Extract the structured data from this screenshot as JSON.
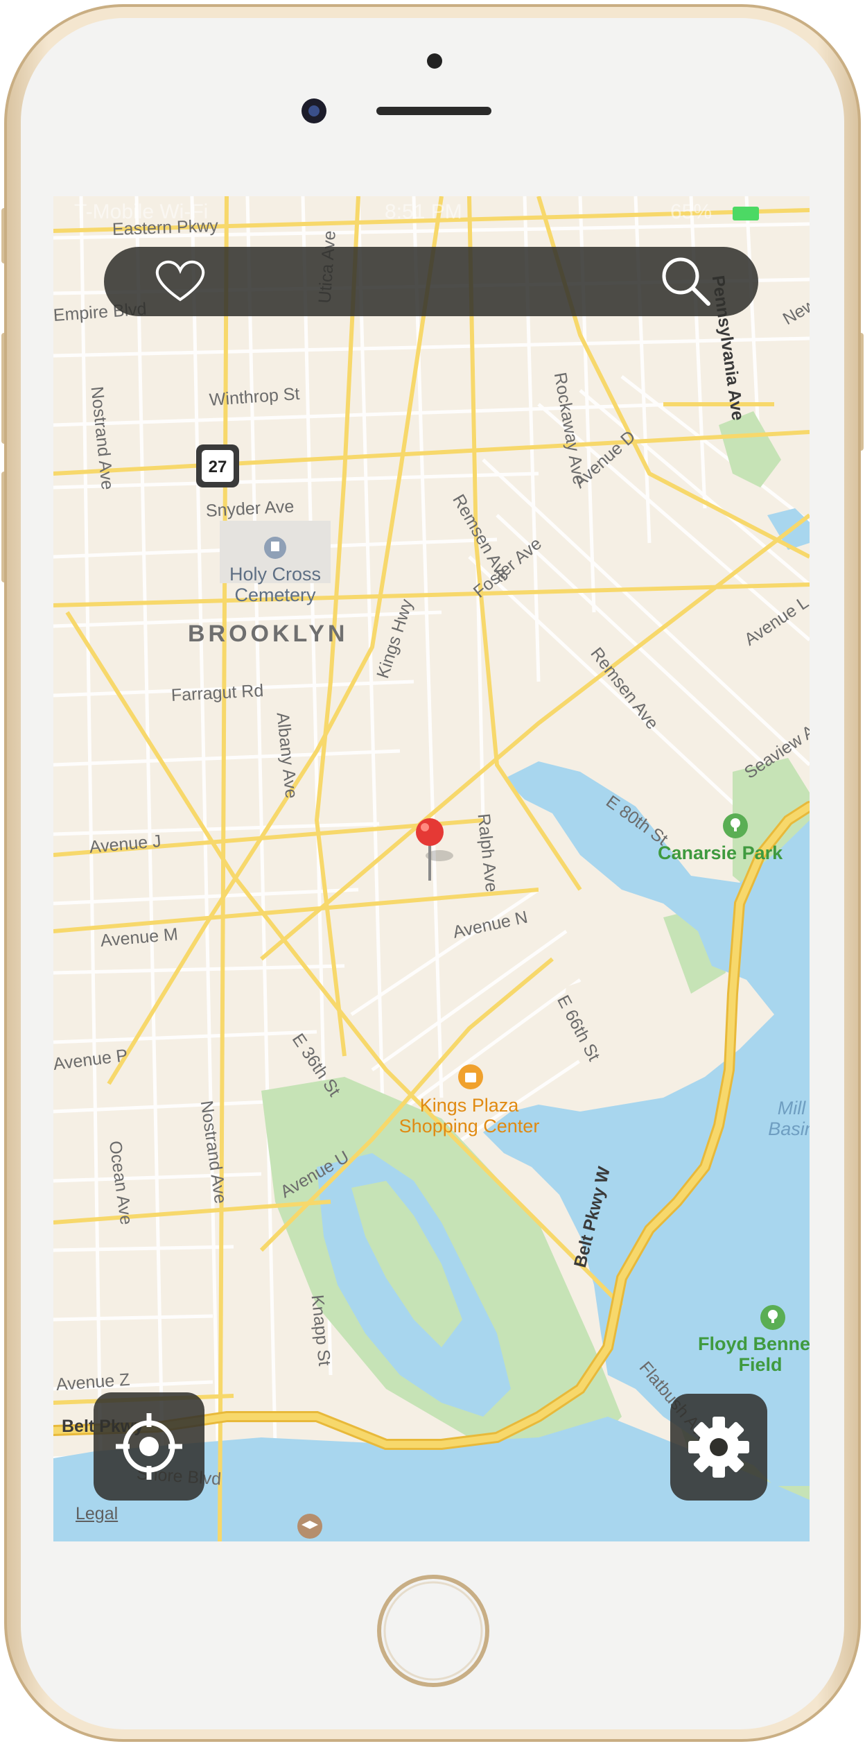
{
  "status_bar": {
    "carrier": "T-Mobile Wi-Fi",
    "time": "8:51 PM",
    "battery": "65%"
  },
  "search_bar": {
    "favorites_icon": "heart-icon",
    "search_icon": "search-icon"
  },
  "map": {
    "area_label": "BROOKLYN",
    "route_shield": "27",
    "legal_link": "Legal",
    "pois": [
      {
        "name": "Holy Cross\nCemetery",
        "icon": "cemetery-icon",
        "color": "#5e6f84"
      },
      {
        "name": "Canarsie Park",
        "icon": "park-icon",
        "color": "#3f9a3f"
      },
      {
        "name": "Kings Plaza\nShopping Center",
        "icon": "shopping-icon",
        "color": "#e79a1c"
      },
      {
        "name": "Floyd Bennett\nField",
        "icon": "park-icon",
        "color": "#3f9a3f"
      },
      {
        "name": "Mill\nBasin",
        "icon": "",
        "color": "#6f9ec1"
      }
    ],
    "streets": [
      "Eastern Pkwy",
      "Pennsylvania Ave",
      "Empire Blvd",
      "Nostrand Ave",
      "Utica Ave",
      "Rockaway Ave",
      "Winthrop St",
      "Remsen Ave",
      "Avenue D",
      "Snyder Ave",
      "Foster Ave",
      "Kings Hwy",
      "Farragut Rd",
      "Albany Ave",
      "Remsen Ave",
      "Avenue L",
      "Seaview Ave",
      "E 80th St",
      "Ralph Ave",
      "Avenue J",
      "Avenue M",
      "Avenue N",
      "E 66th St",
      "Avenue P",
      "E 36th St",
      "Nostrand Ave",
      "Ocean Ave",
      "Avenue U",
      "Belt Pkwy W",
      "Knapp St",
      "Flatbush Ave",
      "Avenue Z",
      "Belt Pkwy",
      "Shore Blvd",
      "New"
    ],
    "pin_icon": "map-pin-icon"
  },
  "controls": {
    "locate_icon": "locate-icon",
    "settings_icon": "gear-icon"
  },
  "colors": {
    "land": "#f5efe4",
    "water": "#a8d6ee",
    "park": "#c6e3b6",
    "major_road": "#f7d86b",
    "highway": "#f7c73e",
    "pin": "#e53935",
    "control_bg": "#30302c"
  }
}
